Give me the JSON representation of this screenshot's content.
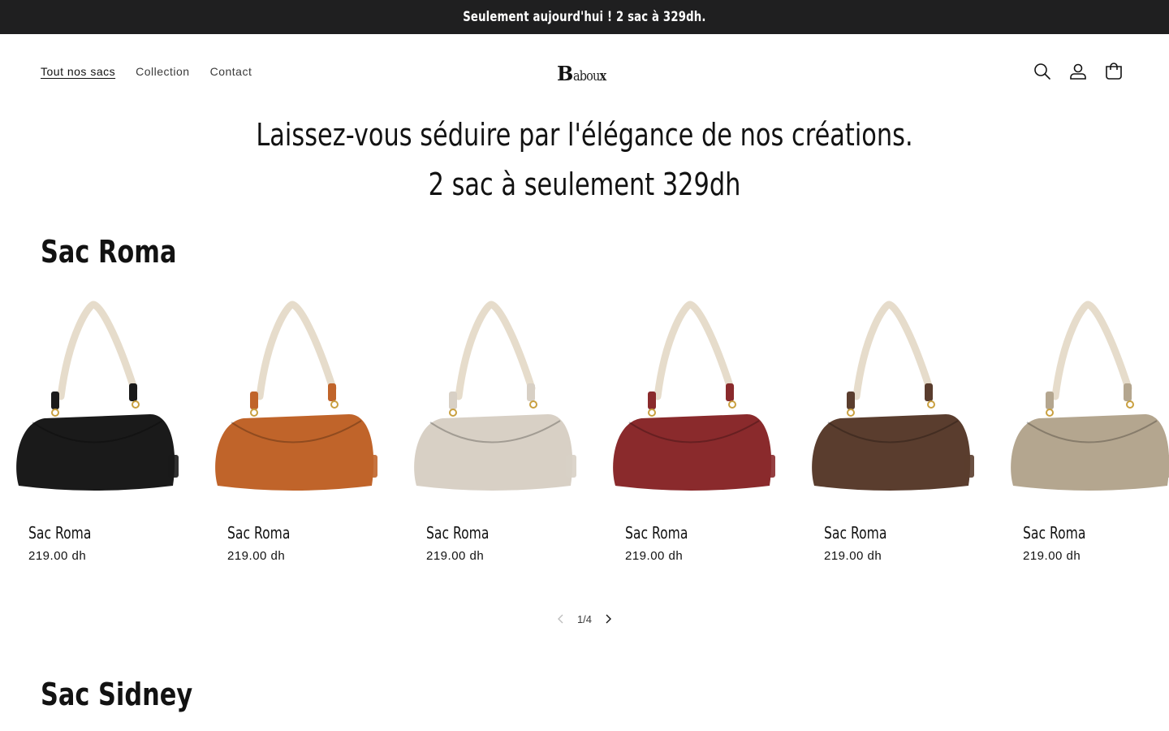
{
  "announcement": {
    "text": "Seulement aujourd'hui ! 2 sac à 329dh."
  },
  "nav": {
    "items": [
      {
        "label": "Tout nos sacs",
        "active": true
      },
      {
        "label": "Collection",
        "active": false
      },
      {
        "label": "Contact",
        "active": false
      }
    ]
  },
  "logo": {
    "first": "B",
    "middle": "abou",
    "last": "x"
  },
  "header_icons": [
    "search-icon",
    "account-icon",
    "cart-icon"
  ],
  "hero": {
    "line1": "Laissez-vous séduire par l'élégance de nos créations.",
    "line2": "2 sac à seulement 329dh"
  },
  "sections": [
    {
      "title": "Sac Roma",
      "products": [
        {
          "name": "Sac Roma",
          "price": "219.00 dh",
          "color": "#1a1a1a"
        },
        {
          "name": "Sac Roma",
          "price": "219.00 dh",
          "color": "#c0642a"
        },
        {
          "name": "Sac Roma",
          "price": "219.00 dh",
          "color": "#d8d0c5"
        },
        {
          "name": "Sac Roma",
          "price": "219.00 dh",
          "color": "#8a2a2c"
        },
        {
          "name": "Sac Roma",
          "price": "219.00 dh",
          "color": "#5a3d2e"
        },
        {
          "name": "Sac Roma",
          "price": "219.00 dh",
          "color": "#b4a68f"
        }
      ],
      "pager": {
        "text": "1/4"
      }
    },
    {
      "title": "Sac Sidney"
    }
  ],
  "colors": {
    "announcement_bg": "#1f1f20",
    "text": "#121212",
    "strap": "#e6dccb",
    "hardware": "#c9a040"
  }
}
